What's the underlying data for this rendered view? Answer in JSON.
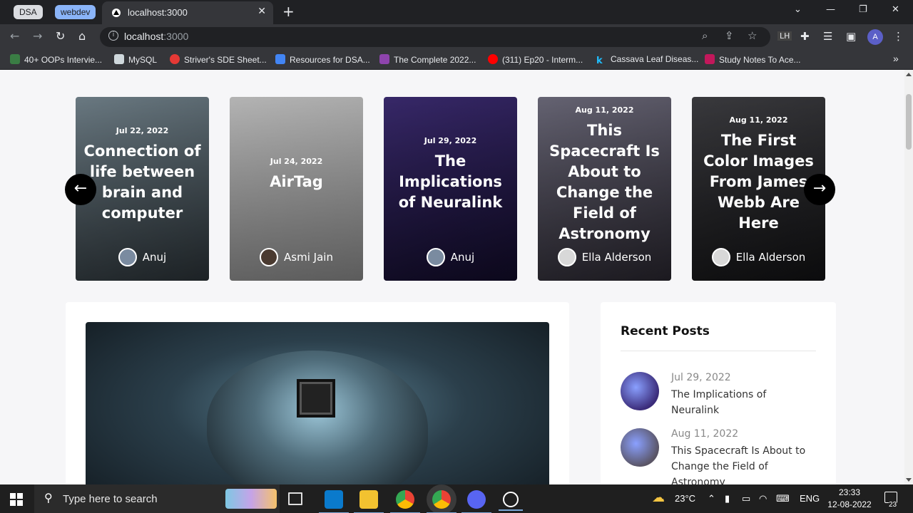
{
  "browser": {
    "tab_groups": [
      "DSA",
      "webdev"
    ],
    "active_tab": {
      "title": "localhost:3000",
      "close": "✕"
    },
    "new_tab": "+",
    "window_controls": {
      "dropdown": "⌄",
      "minimize": "—",
      "restore": "❐",
      "close": "✕"
    },
    "nav": {
      "back": "←",
      "forward": "→",
      "reload": "↻",
      "home": "⌂"
    },
    "address": {
      "host": "localhost",
      "port": ":3000"
    },
    "toolbar_icons": [
      "zoom-icon",
      "share-icon",
      "star-icon",
      "lighthouse-icon",
      "extensions-icon",
      "reading-list-icon",
      "sidebar-icon"
    ],
    "profile_initial": "A",
    "bookmarks": [
      {
        "label": "40+ OOPs Intervie...",
        "color": "#3a7d44"
      },
      {
        "label": "MySQL",
        "color": "#cfd8dc"
      },
      {
        "label": "Striver's SDE Sheet...",
        "color": "#e53935"
      },
      {
        "label": "Resources for DSA...",
        "color": "#4285f4"
      },
      {
        "label": "The Complete 2022...",
        "color": "#8e44ad"
      },
      {
        "label": "(311) Ep20 - Interm...",
        "color": "#ff0000"
      },
      {
        "label": "Cassava Leaf Diseas...",
        "color": "#20beff"
      },
      {
        "label": "Study Notes To Ace...",
        "color": "#c2185b"
      }
    ],
    "bookmarks_more": "»"
  },
  "carousel": {
    "prev": "←",
    "next": "→",
    "cards": [
      {
        "date": "Jul 22, 2022",
        "title": "Connection of life between brain and computer",
        "author": "Anuj",
        "bg": "#6f7f88",
        "bg2": "#2c3439",
        "avatar": "#7a8ba0"
      },
      {
        "date": "Jul 24, 2022",
        "title": "AirTag",
        "author": "Asmi Jain",
        "bg": "#bdbdbd",
        "bg2": "#8d8d8d",
        "avatar": "#4a3a30"
      },
      {
        "date": "Jul 29, 2022",
        "title": "The Implications of Neuralink",
        "author": "Anuj",
        "bg": "#3a2a6e",
        "bg2": "#120c2a",
        "avatar": "#7a8ba0"
      },
      {
        "date": "Aug 11, 2022",
        "title": "This Spacecraft Is About to Change the Field of Astronomy",
        "author": "Ella Alderson",
        "bg": "#6a6878",
        "bg2": "#2a2730",
        "avatar": "#d8d8d8"
      },
      {
        "date": "Aug 11, 2022",
        "title": "The First Color Images From James Webb Are Here",
        "author": "Ella Alderson",
        "bg": "#3c3c40",
        "bg2": "#121214",
        "avatar": "#d8d8d8"
      }
    ]
  },
  "recent": {
    "heading": "Recent Posts",
    "posts": [
      {
        "date": "Jul 29, 2022",
        "title": "The Implications of Neuralink",
        "thumb": "#3b2c7a"
      },
      {
        "date": "Aug 11, 2022",
        "title": "This Spacecraft Is About to Change the Field of Astronomy",
        "thumb": "#5a5566"
      }
    ]
  },
  "taskbar": {
    "search_placeholder": "Type here to search",
    "apps": [
      "task-view-icon",
      "vscode-icon",
      "file-explorer-icon",
      "chrome-icon",
      "chrome-profile-icon",
      "discord-icon",
      "clock-app-icon"
    ],
    "weather": "23°C",
    "language": "ENG",
    "time": "23:33",
    "date": "12-08-2022",
    "notifications": "23"
  }
}
